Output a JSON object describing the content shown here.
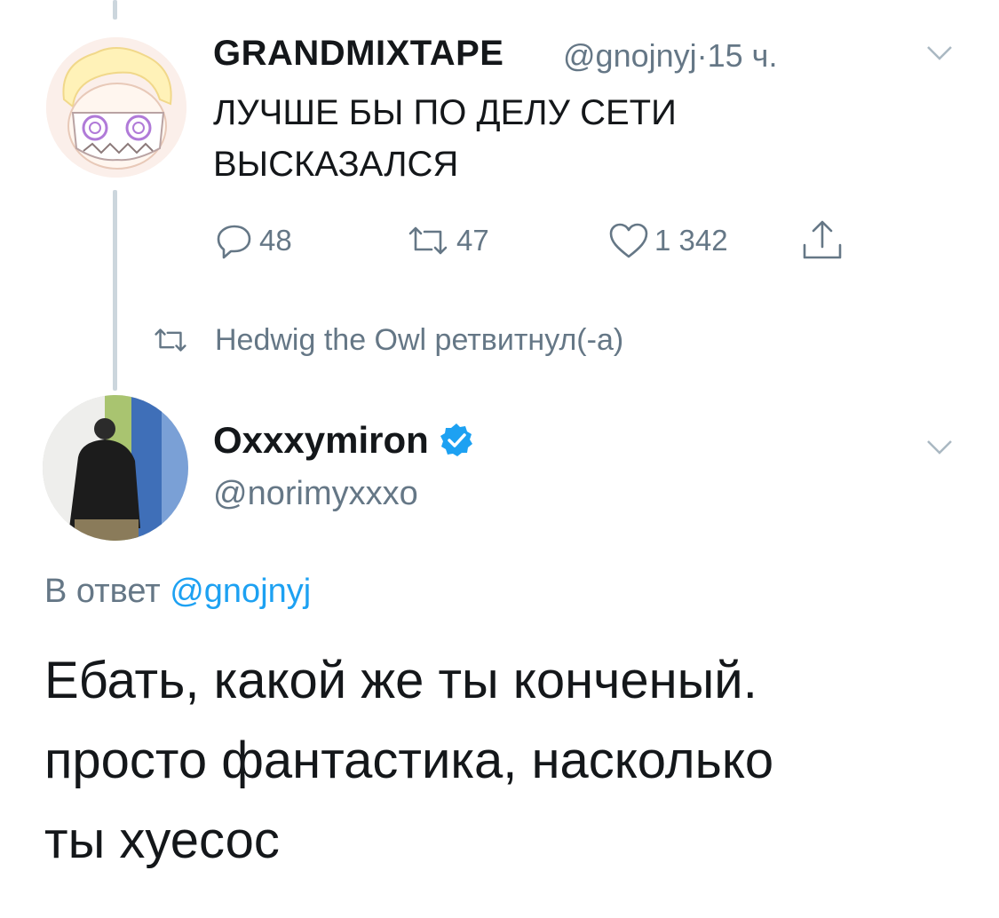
{
  "tweet1": {
    "display_name": "GRANDMIXTAPE",
    "handle": "@gnojnyj",
    "separator": "·",
    "time": "15 ч.",
    "text_line1": "ЛУЧШЕ БЫ ПО ДЕЛУ СЕТИ",
    "text_line2": "ВЫСКАЗАЛСЯ",
    "replies": "48",
    "retweets": "47",
    "likes": "1 342",
    "avatar_icon": "cartoon-avatar-icon"
  },
  "retweet_notice": {
    "text": "Hedwig the Owl ретвитнул(-а)",
    "icon": "retweet-icon"
  },
  "tweet2": {
    "display_name": "Oxxxymiron",
    "handle": "@norimyxxxo",
    "verified": true,
    "reply_prefix": "В ответ",
    "reply_mention": "@gnojnyj",
    "text_line1": "Ебать, какой же ты конченый.",
    "text_line2": "просто фантастика, насколько",
    "text_line3": "ты хуесос",
    "avatar_icon": "photo-avatar-icon"
  },
  "colors": {
    "text": "#14171a",
    "secondary": "#657786",
    "link": "#1da1f2",
    "thread_line": "#ccd6dd"
  }
}
